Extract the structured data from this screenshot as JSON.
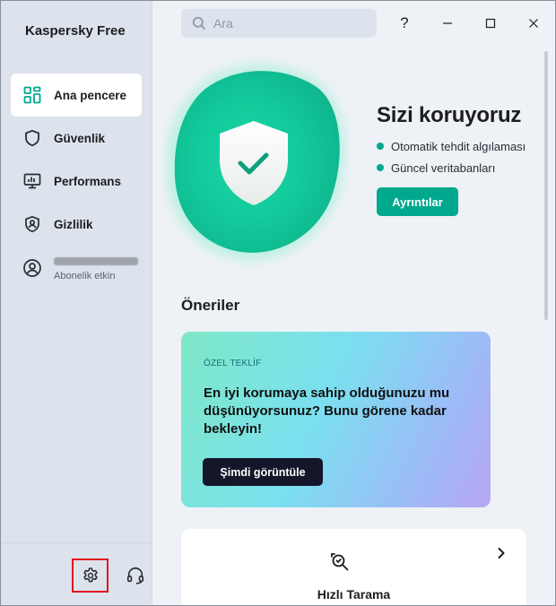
{
  "app": {
    "name": "Kaspersky Free"
  },
  "sidebar": {
    "items": [
      {
        "label": "Ana pencere",
        "icon": "dashboard-icon",
        "active": true
      },
      {
        "label": "Güvenlik",
        "icon": "shield-icon",
        "active": false
      },
      {
        "label": "Performans",
        "icon": "monitor-icon",
        "active": false
      },
      {
        "label": "Gizlilik",
        "icon": "privacy-shield-icon",
        "active": false
      }
    ],
    "account": {
      "icon": "user-icon",
      "subscription": "Abonelik etkin"
    },
    "bottom": {
      "settings_icon": "gear-icon",
      "support_icon": "headset-icon"
    }
  },
  "search": {
    "placeholder": "Ara",
    "value": ""
  },
  "titlebar": {
    "help": "?",
    "minimize_icon": "minimize-icon",
    "maximize_icon": "maximize-icon",
    "close_icon": "close-icon"
  },
  "hero": {
    "title": "Sizi koruyoruz",
    "features": [
      "Otomatik tehdit algılaması",
      "Güncel veritabanları"
    ],
    "details_button": "Ayrıntılar"
  },
  "recommendations": {
    "title": "Öneriler",
    "offer": {
      "tag": "ÖZEL TEKLİF",
      "headline": "En iyi korumaya sahip olduğunuzu mu düşünüyorsunuz? Bunu görene kadar bekleyin!",
      "cta": "Şimdi görüntüle"
    }
  },
  "quick_scan": {
    "label": "Hızlı Tarama",
    "icon": "scan-search-icon"
  },
  "colors": {
    "accent": "#00a88e",
    "sidebar_bg": "#dde3ec",
    "main_bg": "#eef1f6",
    "alert_outline": "#e0141e"
  }
}
